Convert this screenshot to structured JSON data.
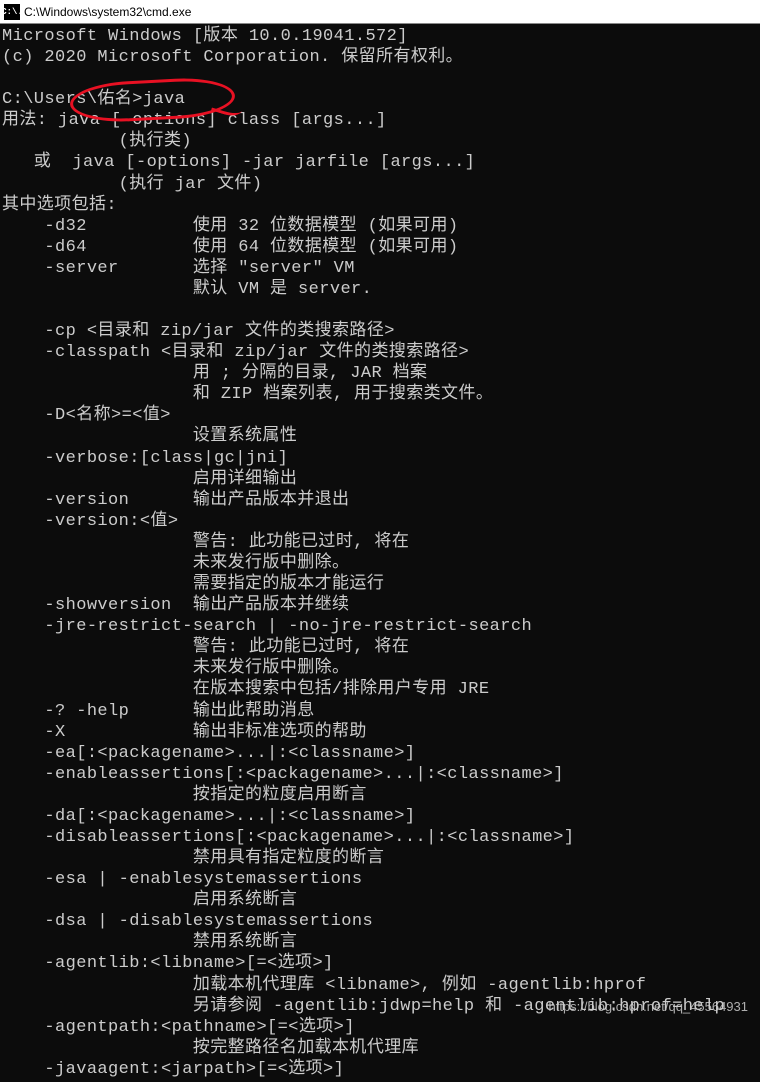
{
  "titlebar": {
    "icon_text": "C:\\.",
    "path": "C:\\Windows\\system32\\cmd.exe"
  },
  "terminal": {
    "lines": [
      "Microsoft Windows [版本 10.0.19041.572]",
      "(c) 2020 Microsoft Corporation. 保留所有权利。",
      "",
      "C:\\Users\\佑名>java",
      "用法: java [-options] class [args...]",
      "           (执行类)",
      "   或  java [-options] -jar jarfile [args...]",
      "           (执行 jar 文件)",
      "其中选项包括:",
      "    -d32          使用 32 位数据模型 (如果可用)",
      "    -d64          使用 64 位数据模型 (如果可用)",
      "    -server       选择 \"server\" VM",
      "                  默认 VM 是 server.",
      "",
      "    -cp <目录和 zip/jar 文件的类搜索路径>",
      "    -classpath <目录和 zip/jar 文件的类搜索路径>",
      "                  用 ; 分隔的目录, JAR 档案",
      "                  和 ZIP 档案列表, 用于搜索类文件。",
      "    -D<名称>=<值>",
      "                  设置系统属性",
      "    -verbose:[class|gc|jni]",
      "                  启用详细输出",
      "    -version      输出产品版本并退出",
      "    -version:<值>",
      "                  警告: 此功能已过时, 将在",
      "                  未来发行版中删除。",
      "                  需要指定的版本才能运行",
      "    -showversion  输出产品版本并继续",
      "    -jre-restrict-search | -no-jre-restrict-search",
      "                  警告: 此功能已过时, 将在",
      "                  未来发行版中删除。",
      "                  在版本搜索中包括/排除用户专用 JRE",
      "    -? -help      输出此帮助消息",
      "    -X            输出非标准选项的帮助",
      "    -ea[:<packagename>...|:<classname>]",
      "    -enableassertions[:<packagename>...|:<classname>]",
      "                  按指定的粒度启用断言",
      "    -da[:<packagename>...|:<classname>]",
      "    -disableassertions[:<packagename>...|:<classname>]",
      "                  禁用具有指定粒度的断言",
      "    -esa | -enablesystemassertions",
      "                  启用系统断言",
      "    -dsa | -disablesystemassertions",
      "                  禁用系统断言",
      "    -agentlib:<libname>[=<选项>]",
      "                  加载本机代理库 <libname>, 例如 -agentlib:hprof",
      "                  另请参阅 -agentlib:jdwp=help 和 -agentlib:hprof=help",
      "    -agentpath:<pathname>[=<选项>]",
      "                  按完整路径名加载本机代理库",
      "    -javaagent:<jarpath>[=<选项>]"
    ]
  },
  "watermark": "https://blog.csdn.net/qq_45564931"
}
